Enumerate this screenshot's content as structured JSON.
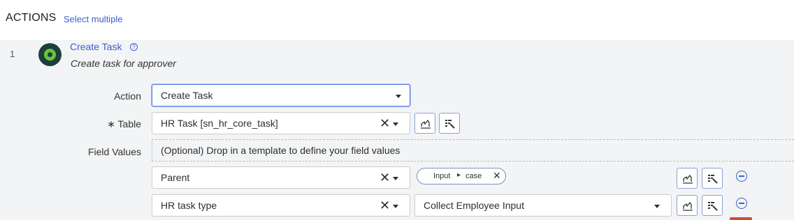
{
  "header": {
    "title": "ACTIONS",
    "select_multiple": "Select multiple"
  },
  "step": {
    "number": "1",
    "title": "Create Task",
    "description": "Create task for approver"
  },
  "form": {
    "action": {
      "label": "Action",
      "value": "Create Task"
    },
    "table": {
      "required_mark": "∗",
      "label": "Table",
      "value": "HR Task [sn_hr_core_task]"
    },
    "field_values": {
      "label": "Field Values",
      "drop_hint": "(Optional) Drop in a template to define your field values",
      "rows": [
        {
          "field": "Parent",
          "pill": {
            "part1": "Input",
            "separator": "▸",
            "part2": "case"
          }
        },
        {
          "field": "HR task type",
          "value": "Collect Employee Input"
        }
      ]
    }
  },
  "icons": {
    "step": "step-status-icon",
    "help": "help-icon",
    "clear": "clear-x-icon",
    "dropdown": "chevron-down-icon",
    "data_pill_picker": "data-pill-picker-icon",
    "reference_lookup": "reference-lookup-icon",
    "remove": "remove-row-icon"
  },
  "colors": {
    "link": "#3a5fcd",
    "panel_bg": "#f3f4f5",
    "icon_green": "#6cc23a",
    "icon_dark": "#1d3f3c"
  }
}
